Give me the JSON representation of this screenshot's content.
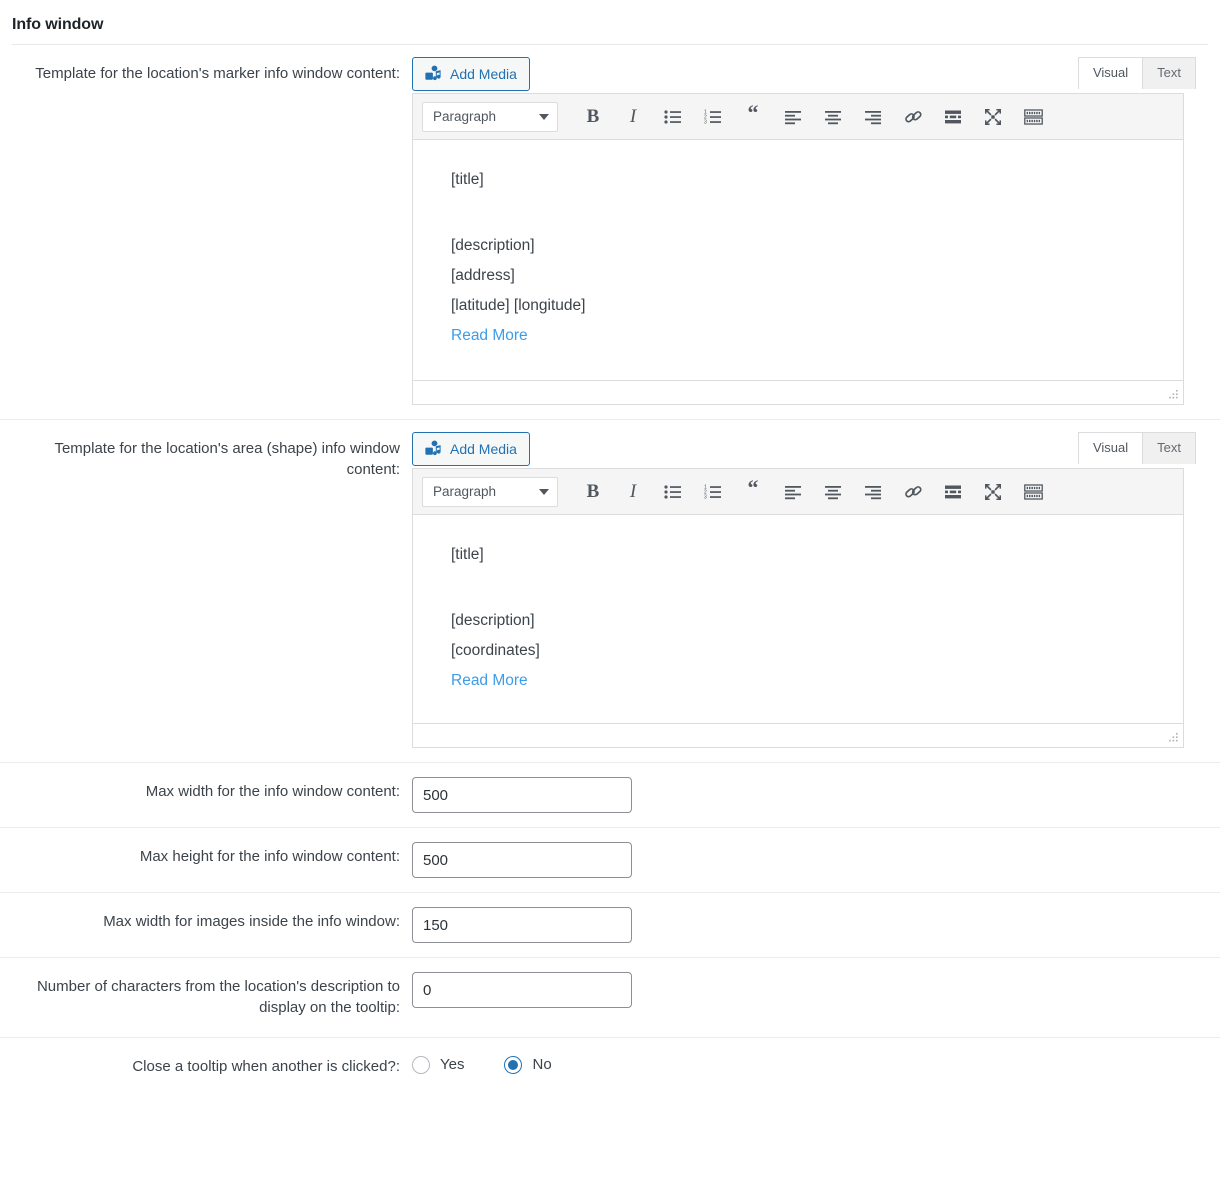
{
  "section": {
    "title": "Info window"
  },
  "rows": {
    "marker_template": {
      "label": "Template for the location's marker info window content:",
      "add_media_label": "Add Media",
      "tabs": {
        "visual": "Visual",
        "text": "Text"
      },
      "active_tab": "Visual",
      "format_select": "Paragraph",
      "content": {
        "title": "[title]",
        "lines": [
          "[description]",
          "[address]",
          "[latitude] [longitude]"
        ],
        "link": "Read More"
      }
    },
    "area_template": {
      "label": "Template for the location's area (shape) info window content:",
      "add_media_label": "Add Media",
      "tabs": {
        "visual": "Visual",
        "text": "Text"
      },
      "active_tab": "Visual",
      "format_select": "Paragraph",
      "content": {
        "title": "[title]",
        "lines": [
          "[description]",
          "[coordinates]"
        ],
        "link": "Read More"
      }
    },
    "max_width_content": {
      "label": "Max width for the info window content:",
      "value": "500"
    },
    "max_height_content": {
      "label": "Max height for the info window content:",
      "value": "500"
    },
    "max_width_images": {
      "label": "Max width for images inside the info window:",
      "value": "150"
    },
    "tooltip_chars": {
      "label": "Number of characters from the location's description to display on the tooltip:",
      "value": "0"
    },
    "close_tooltip": {
      "label": "Close a tooltip when another is clicked?:",
      "options": [
        {
          "label": "Yes",
          "selected": false
        },
        {
          "label": "No",
          "selected": true
        }
      ]
    }
  },
  "toolbar_icons": [
    "bold-icon",
    "italic-icon",
    "bulleted-list-icon",
    "numbered-list-icon",
    "blockquote-icon",
    "align-left-icon",
    "align-center-icon",
    "align-right-icon",
    "insert-link-icon",
    "read-more-tag-icon",
    "fullscreen-icon",
    "toolbar-toggle-icon"
  ],
  "colors": {
    "accent": "#2271b1",
    "link": "#3d9ce8",
    "text": "#3c434a",
    "border": "#dcdcde"
  }
}
